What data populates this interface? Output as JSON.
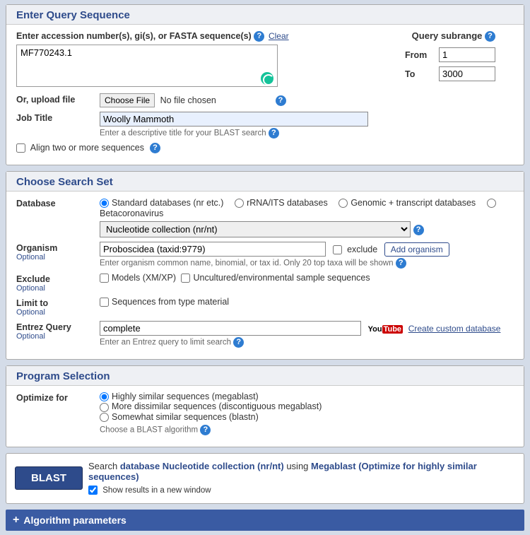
{
  "seq": {
    "header": "Enter Query Sequence",
    "prompt": "Enter accession number(s), gi(s), or FASTA sequence(s)",
    "clear": "Clear",
    "value": "MF770243.1",
    "subrange_title": "Query subrange",
    "from_label": "From",
    "from_value": "1",
    "to_label": "To",
    "to_value": "3000",
    "upload_label": "Or, upload file",
    "choose_file": "Choose File",
    "no_file": "No file chosen",
    "jobtitle_label": "Job Title",
    "jobtitle_value": "Woolly Mammoth",
    "jobtitle_help": "Enter a descriptive title for your BLAST search",
    "align_two": "Align two or more sequences"
  },
  "search": {
    "header": "Choose Search Set",
    "db_label": "Database",
    "db_options": {
      "std": "Standard databases (nr etc.)",
      "rrna": "rRNA/ITS databases",
      "genomic": "Genomic + transcript databases",
      "beta": "Betacoronavirus"
    },
    "db_select": "Nucleotide collection (nr/nt)",
    "org_label": "Organism",
    "optional": "Optional",
    "org_value": "Proboscidea (taxid:9779)",
    "exclude_cb": "exclude",
    "add_org": "Add organism",
    "org_help": "Enter organism common name, binomial, or tax id. Only 20 top taxa will be shown",
    "exclude_label": "Exclude",
    "exclude_models": "Models (XM/XP)",
    "exclude_uncultured": "Uncultured/environmental sample sequences",
    "limit_label": "Limit to",
    "limit_seq": "Sequences from type material",
    "entrez_label": "Entrez Query",
    "entrez_value": "complete",
    "custom_db": "Create custom database",
    "entrez_help": "Enter an Entrez query to limit search"
  },
  "program": {
    "header": "Program Selection",
    "optimize_label": "Optimize for",
    "opt_mega": "Highly similar sequences (megablast)",
    "opt_disc": "More dissimilar sequences (discontiguous megablast)",
    "opt_blastn": "Somewhat similar sequences (blastn)",
    "choose_help": "Choose a BLAST algorithm"
  },
  "footer": {
    "blast_btn": "BLAST",
    "search_word": "Search",
    "db_text": "database Nucleotide collection (nr/nt)",
    "using": "using",
    "alg_text": "Megablast (Optimize for highly similar sequences)",
    "show_new": "Show results in a new window"
  },
  "algo_params": "Algorithm parameters"
}
